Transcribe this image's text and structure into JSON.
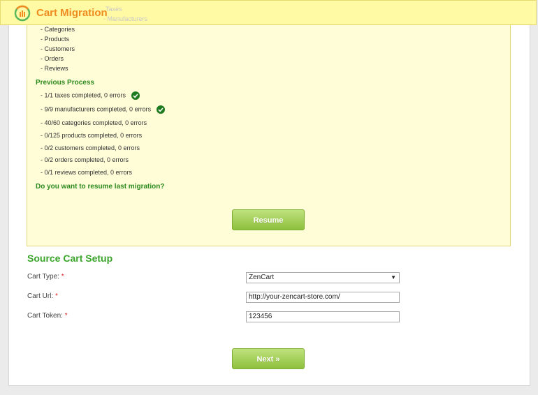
{
  "header": {
    "brand": "Cart Migration",
    "ghost_lines": [
      "Taxes",
      "- Manufacturers"
    ]
  },
  "entities": [
    "- Categories",
    "- Products",
    "- Customers",
    "- Orders",
    "- Reviews"
  ],
  "previous_process": {
    "title": "Previous Process",
    "items": [
      {
        "text": "- 1/1 taxes completed, 0 errors",
        "done": true
      },
      {
        "text": "- 9/9 manufacturers completed, 0 errors",
        "done": true
      },
      {
        "text": "- 40/60 categories completed, 0 errors",
        "done": false
      },
      {
        "text": "- 0/125 products completed, 0 errors",
        "done": false
      },
      {
        "text": "- 0/2 customers completed, 0 errors",
        "done": false
      },
      {
        "text": "- 0/2 orders completed, 0 errors",
        "done": false
      },
      {
        "text": "- 0/1 reviews completed, 0 errors",
        "done": false
      }
    ],
    "question": "Do you want to resume last migration?",
    "resume_label": "Resume"
  },
  "source_setup": {
    "title": "Source Cart Setup",
    "cart_type_label": "Cart Type:",
    "cart_type_value": "ZenCart",
    "cart_url_label": "Cart Url:",
    "cart_url_value": "http://your-zencart-store.com/",
    "cart_token_label": "Cart Token:",
    "cart_token_value": "123456",
    "required_mark": "*",
    "next_label": "Next »"
  },
  "colors": {
    "accent_green": "#3aa52a",
    "brand_orange": "#f08b1f",
    "panel_yellow": "#fffcd8"
  }
}
